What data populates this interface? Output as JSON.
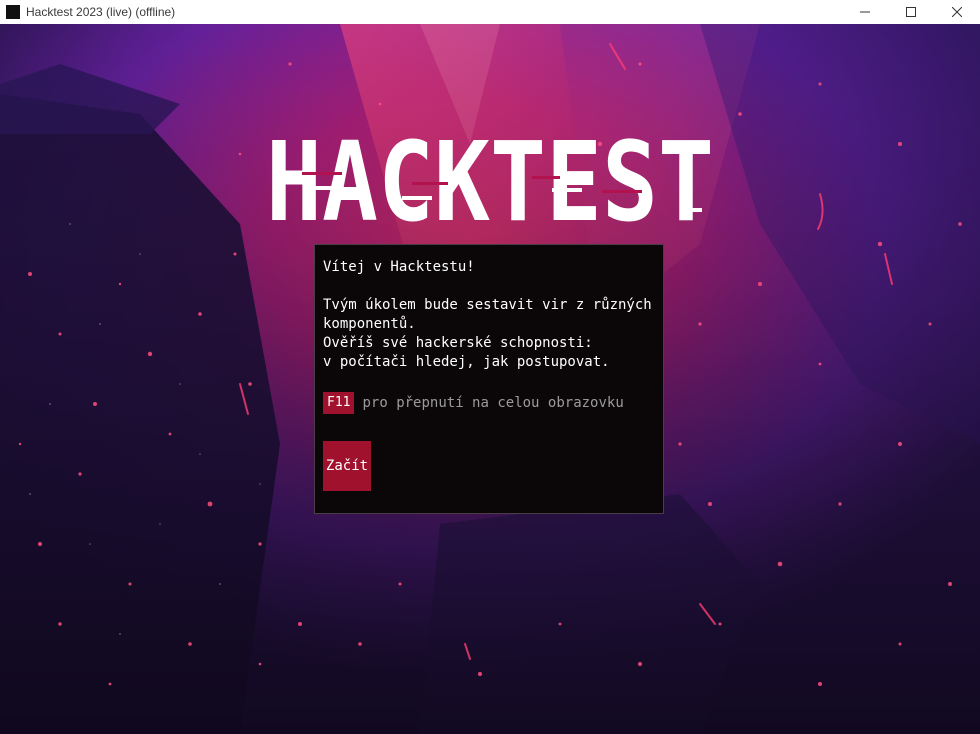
{
  "window": {
    "title": "Hacktest 2023 (live) (offline)",
    "controls": [
      "minimize-icon",
      "maximize-icon",
      "close-icon"
    ]
  },
  "hero": {
    "logo_text": "HACKTEST"
  },
  "dialog": {
    "greeting": "Vítej v Hacktestu!",
    "body_lines": [
      "Tvým úkolem bude sestavit vir z různých",
      "komponentů.",
      "Ověříš své hackerské schopnosti:",
      "v počítači hledej, jak postupovat."
    ],
    "fullscreen_key": "F11",
    "fullscreen_hint": "pro přepnutí na celou obrazovku",
    "start_label": "Začít"
  },
  "colors": {
    "accent": "#a0112d",
    "dialog_bg": "#0b0709",
    "bg_pink": "#d2246e",
    "bg_purple": "#5a1a8c",
    "bg_dark": "#1b0f33"
  }
}
